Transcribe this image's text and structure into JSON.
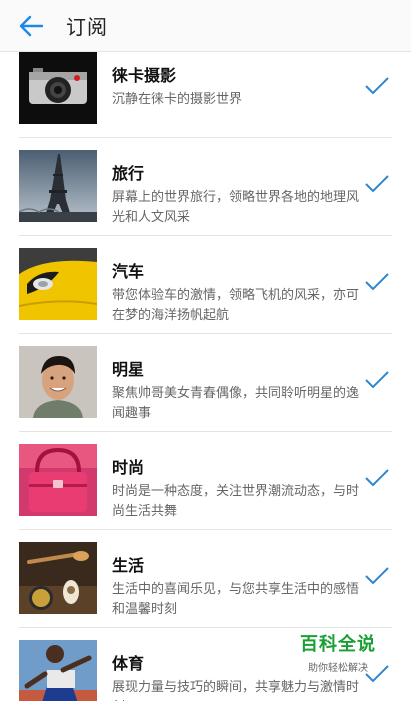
{
  "header": {
    "title": "订阅",
    "back_icon": "arrow-left-icon",
    "accent": "#1e88e5"
  },
  "check_color": "#2f86d0",
  "items": [
    {
      "name": "徕卡摄影",
      "desc": "沉静在徕卡的摄影世界",
      "image": "camera",
      "subscribed": true
    },
    {
      "name": "旅行",
      "desc": "屏幕上的世界旅行，领略世界各地的地理风光和人文风采",
      "image": "eiffel-tower",
      "subscribed": true
    },
    {
      "name": "汽车",
      "desc": "带您体验车的激情，领略飞机的风采，亦可在梦的海洋扬帆起航",
      "image": "yellow-car",
      "subscribed": true
    },
    {
      "name": "明星",
      "desc": "聚焦帅哥美女青春偶像，共同聆听明星的逸闻趣事",
      "image": "smiling-man",
      "subscribed": true
    },
    {
      "name": "时尚",
      "desc": "时尚是一种态度，关注世界潮流动态，与时尚生活共舞",
      "image": "pink-handbag",
      "subscribed": true
    },
    {
      "name": "生活",
      "desc": "生活中的喜闻乐见，与您共享生活中的感悟和温馨时刻",
      "image": "spices",
      "subscribed": true
    },
    {
      "name": "体育",
      "desc": "展现力量与技巧的瞬间，共享魅力与激情时刻",
      "image": "runner",
      "subscribed": true
    }
  ],
  "watermark": {
    "title": "百科全说",
    "subtitle": "助你轻松解决"
  }
}
